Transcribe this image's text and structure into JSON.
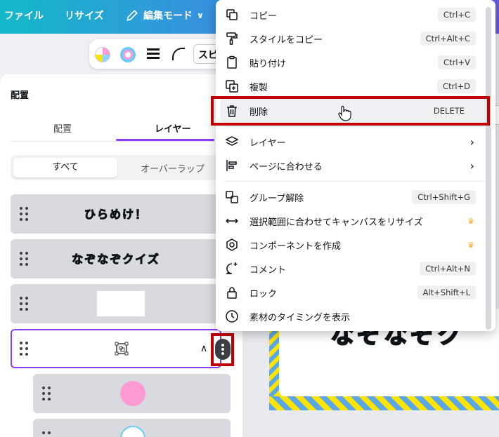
{
  "topbar": {
    "file": "ファイル",
    "resize": "リサイズ",
    "edit_mode": "編集モード"
  },
  "toolbar": {
    "speed_label": "スピ"
  },
  "panel": {
    "title": "配置",
    "tabs": [
      "配置",
      "レイヤー"
    ],
    "active_tab": "レイヤー",
    "filter": [
      "すべて",
      "オーバーラップ"
    ],
    "layers": [
      {
        "type": "text",
        "text": "ひらめけ！"
      },
      {
        "type": "text",
        "text": "なぞなぞクイズ"
      },
      {
        "type": "shape"
      },
      {
        "type": "group",
        "selected": true
      },
      {
        "type": "circle-pink"
      },
      {
        "type": "circle-outline"
      }
    ]
  },
  "context_menu": {
    "items": [
      {
        "label": "コピー",
        "shortcut": "Ctrl+C",
        "icon": "copy-icon"
      },
      {
        "label": "スタイルをコピー",
        "shortcut": "Ctrl+Alt+C",
        "icon": "paint-roller-icon"
      },
      {
        "label": "貼り付け",
        "shortcut": "Ctrl+V",
        "icon": "clipboard-icon"
      },
      {
        "label": "複製",
        "shortcut": "Ctrl+D",
        "icon": "duplicate-icon"
      },
      {
        "label": "削除",
        "shortcut": "DELETE",
        "icon": "trash-icon"
      },
      {
        "label": "レイヤー",
        "icon": "layers-icon"
      },
      {
        "label": "ページに合わせる",
        "icon": "align-icon"
      },
      {
        "label": "グループ解除",
        "shortcut": "Ctrl+Shift+G",
        "icon": "ungroup-icon"
      },
      {
        "label": "選択範囲に合わせてキャンバスをリサイズ",
        "icon": "resize-arrows-icon"
      },
      {
        "label": "コンポーネントを作成",
        "icon": "hexagon-icon"
      },
      {
        "label": "コメント",
        "shortcut": "Ctrl+Alt+N",
        "icon": "comment-icon"
      },
      {
        "label": "ロック",
        "shortcut": "Alt+Shift+L",
        "icon": "lock-icon"
      },
      {
        "label": "素材のタイミングを表示",
        "icon": "clock-icon"
      }
    ]
  },
  "colors": {
    "accent": "#8b3dff",
    "highlight": "#c00000",
    "design_yellow": "#ffe400"
  }
}
